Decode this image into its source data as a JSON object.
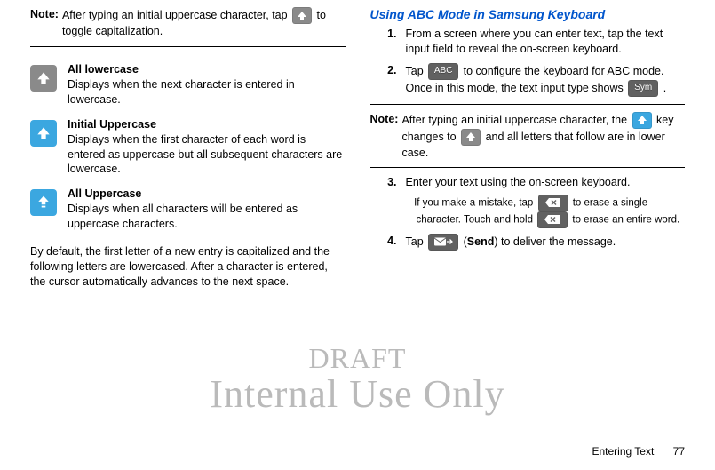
{
  "left": {
    "note_label": "Note:",
    "note_text_before": "After typing an initial uppercase character, tap ",
    "note_text_after": " to toggle capitalization.",
    "modes": [
      {
        "title": "All lowercase",
        "desc": "Displays when the next character is entered in lowercase."
      },
      {
        "title": "Initial Uppercase",
        "desc": "Displays when the first character of each word is entered as uppercase but all subsequent characters are lowercase."
      },
      {
        "title": "All Uppercase",
        "desc": "Displays when all characters will be entered as uppercase characters."
      }
    ],
    "paragraph": "By default, the first letter of a new entry is capitalized and the following letters are lowercased. After a character is entered, the cursor automatically advances to the next space."
  },
  "right": {
    "section_title": "Using ABC Mode in Samsung Keyboard",
    "step1": {
      "num": "1.",
      "text": "From a screen where you can enter text, tap the text input field to reveal the on-screen keyboard."
    },
    "step2": {
      "num": "2.",
      "before": "Tap ",
      "abc": "ABC",
      "mid": " to configure the keyboard for ABC mode. Once in this mode, the text input type shows ",
      "sym": "Sym",
      "after": "."
    },
    "note_label": "Note:",
    "note_before": "After typing an initial uppercase character, the ",
    "note_mid": " key changes to ",
    "note_after": " and all letters that follow are in lower case.",
    "step3": {
      "num": "3.",
      "text": "Enter your text using the on-screen keyboard.",
      "sub_before": "– If you make a mistake, tap ",
      "sub_mid": " to erase a single character. Touch and hold ",
      "sub_after": " to erase an entire word."
    },
    "step4": {
      "num": "4.",
      "before": "Tap ",
      "after_open": " (",
      "send": "Send",
      "after_close": ") to deliver the message."
    }
  },
  "watermark": {
    "l1": "DRAFT",
    "l2": "Internal Use Only"
  },
  "footer": {
    "section": "Entering Text",
    "page": "77"
  }
}
